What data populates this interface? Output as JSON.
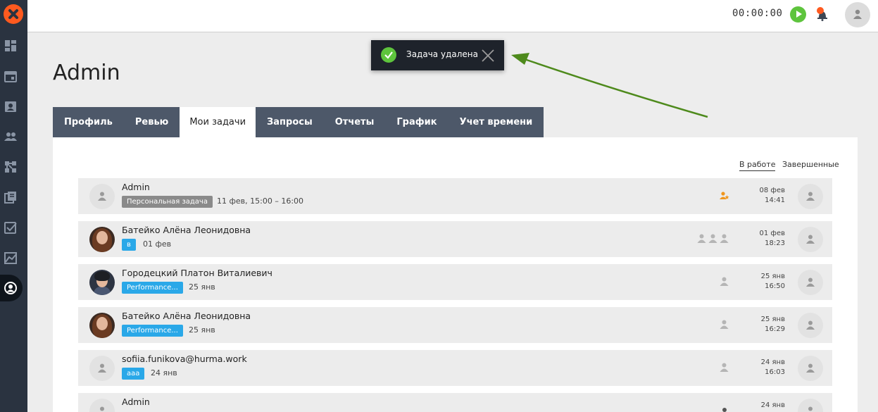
{
  "topbar": {
    "timer": "00:00:00"
  },
  "page": {
    "title": "Admin"
  },
  "tabs": [
    {
      "label": "Профиль"
    },
    {
      "label": "Ревью"
    },
    {
      "label": "Мои задачи",
      "active": true
    },
    {
      "label": "Запросы"
    },
    {
      "label": "Отчеты"
    },
    {
      "label": "График"
    },
    {
      "label": "Учет времени"
    }
  ],
  "filters": {
    "in_progress": "В работе",
    "completed": "Завершенные"
  },
  "tasks": [
    {
      "name": "Admin",
      "badge": "Персональная задача",
      "badge_color": "gray",
      "date": "11 фев, 15:00 – 16:00",
      "ts_date": "08 фев",
      "ts_time": "14:41"
    },
    {
      "name": "Батейко Алёна Леонидовна",
      "badge": "в",
      "badge_color": "blue",
      "date": "01 фев",
      "ts_date": "01 фев",
      "ts_time": "18:23"
    },
    {
      "name": "Городецкий Платон Виталиевич",
      "badge": "Performance...",
      "badge_color": "blue",
      "date": "25 янв",
      "ts_date": "25 янв",
      "ts_time": "16:50"
    },
    {
      "name": "Батейко Алёна Леонидовна",
      "badge": "Performance...",
      "badge_color": "blue",
      "date": "25 янв",
      "ts_date": "25 янв",
      "ts_time": "16:29"
    },
    {
      "name": "sofiia.funikova@hurma.work",
      "badge": "aaa",
      "badge_color": "blue",
      "date": "24 янв",
      "ts_date": "24 янв",
      "ts_time": "16:03"
    },
    {
      "name": "Admin",
      "badge": "",
      "badge_color": "gray",
      "date": "",
      "ts_date": "24 янв",
      "ts_time": ""
    }
  ],
  "toast": {
    "text": "Задача удалена"
  },
  "colors": {
    "sidebar": "#2a3340",
    "tab": "#4d5869",
    "accent_green": "#5ec43d",
    "badge_blue": "#2aa8e8",
    "arrow": "#4e8a1c"
  }
}
